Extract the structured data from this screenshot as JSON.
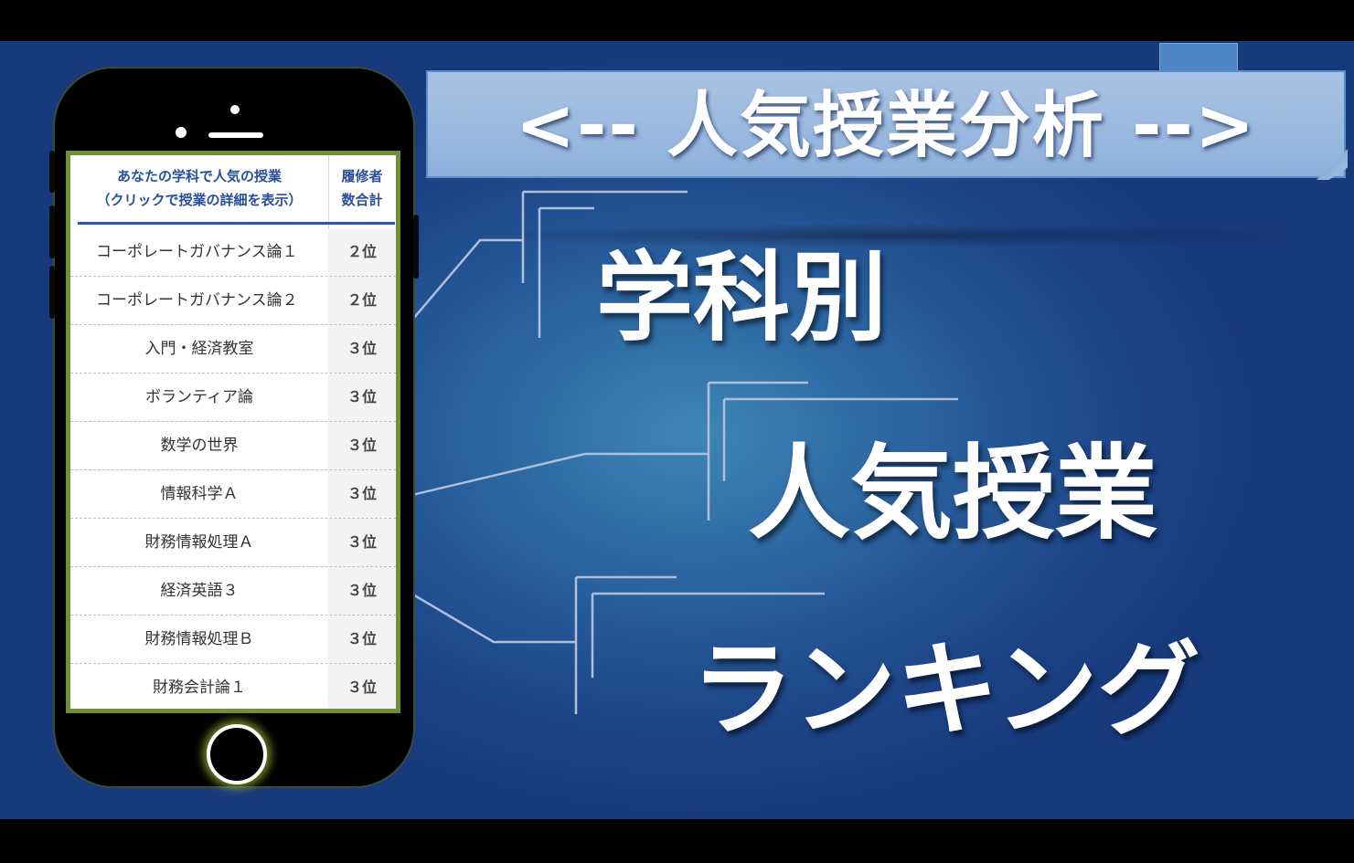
{
  "banner": {
    "title": "<-- 人気授業分析 -->"
  },
  "keywords": [
    "学科別",
    "人気授業",
    "ランキング"
  ],
  "table": {
    "header_course_line1": "あなたの学科で人気の授業",
    "header_course_line2": "（クリックで授業の詳細を表示）",
    "header_rank_line1": "履修者",
    "header_rank_line2": "数合計",
    "rows": [
      {
        "course": "コーポレートガバナンス論１",
        "rank": "２位"
      },
      {
        "course": "コーポレートガバナンス論２",
        "rank": "２位"
      },
      {
        "course": "入門・経済教室",
        "rank": "３位"
      },
      {
        "course": "ボランティア論",
        "rank": "３位"
      },
      {
        "course": "数学の世界",
        "rank": "３位"
      },
      {
        "course": "情報科学Ａ",
        "rank": "３位"
      },
      {
        "course": "財務情報処理Ａ",
        "rank": "３位"
      },
      {
        "course": "経済英語３",
        "rank": "３位"
      },
      {
        "course": "財務情報処理Ｂ",
        "rank": "３位"
      },
      {
        "course": "財務会計論１",
        "rank": "３位"
      }
    ]
  },
  "colors": {
    "accent": "#2a55a8",
    "frame": "#6f8f3a",
    "banner": "#a9c3e3"
  }
}
